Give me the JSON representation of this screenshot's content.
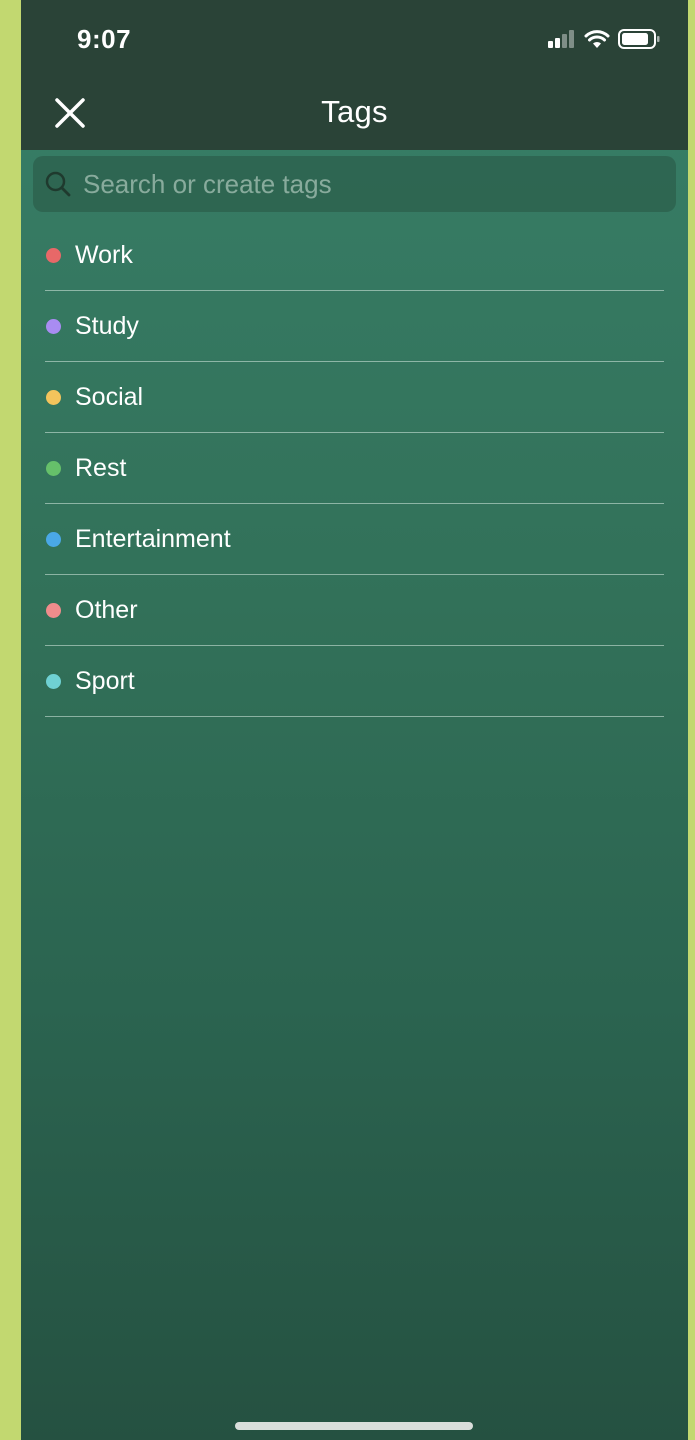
{
  "status_bar": {
    "time": "9:07",
    "icons": [
      "cellular-signal-icon",
      "wifi-icon",
      "battery-icon"
    ]
  },
  "header": {
    "title": "Tags",
    "close_icon": "close-icon"
  },
  "search": {
    "placeholder": "Search or create tags",
    "value": "",
    "icon": "search-icon"
  },
  "tags": [
    {
      "label": "Work",
      "color": "#e86868"
    },
    {
      "label": "Study",
      "color": "#a98cf2"
    },
    {
      "label": "Social",
      "color": "#f3c45c"
    },
    {
      "label": "Rest",
      "color": "#66c06a"
    },
    {
      "label": "Entertainment",
      "color": "#4aa8e6"
    },
    {
      "label": "Other",
      "color": "#f08c8c"
    },
    {
      "label": "Sport",
      "color": "#6fd1d3"
    }
  ],
  "colors": {
    "header_bg": "#2a4337",
    "body_bg_top": "#387f68",
    "body_bg_bottom": "#255141",
    "outer_bg": "#c2d870"
  }
}
